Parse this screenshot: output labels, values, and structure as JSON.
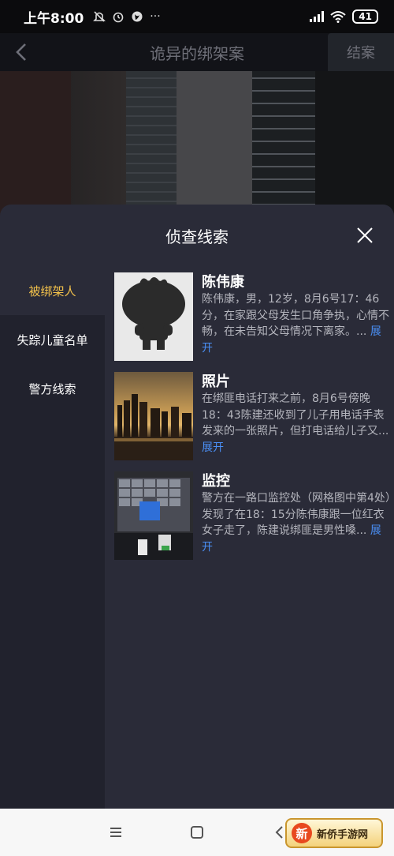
{
  "status_bar": {
    "time": "上午8:00",
    "icons": [
      "mute-icon",
      "alarm-icon",
      "vpn-icon",
      "more-dots-icon"
    ],
    "more": "···",
    "battery": "41"
  },
  "header": {
    "title": "诡异的绑架案",
    "end_label": "结案"
  },
  "panel": {
    "title": "侦查线索"
  },
  "sidebar": {
    "items": [
      {
        "label": "被绑架人",
        "active": true
      },
      {
        "label": "失踪儿童名单",
        "active": false
      },
      {
        "label": "警方线索",
        "active": false
      }
    ]
  },
  "clues": [
    {
      "title": "陈伟康",
      "desc": "陈伟康，男，12岁，8月6号17：46分，在家跟父母发生口角争执，心情不畅，在未告知父母情况下离家。...",
      "more": "展开",
      "thumb": "silhouette-avatar"
    },
    {
      "title": "照片",
      "desc": "在绑匪电话打来之前，8月6号傍晚18：43陈建还收到了儿子用电话手表发来的一张照片，但打电话给儿子又...",
      "more": "展开",
      "thumb": "city-sunset-photo"
    },
    {
      "title": "监控",
      "desc": "警方在一路口监控处（网格图中第4处）发现了在18：15分陈伟康跟一位红衣女子走了，陈建说绑匪是男性嗓...",
      "more": "展开",
      "thumb": "surveillance-monitors-photo"
    }
  ],
  "watermark": {
    "logo": "新",
    "text": "新侨手游网"
  },
  "colors": {
    "accent_active": "#f3c24b",
    "link": "#4a8ff5",
    "panel_bg": "#2a2b38",
    "sidebar_bg": "#21222d"
  }
}
